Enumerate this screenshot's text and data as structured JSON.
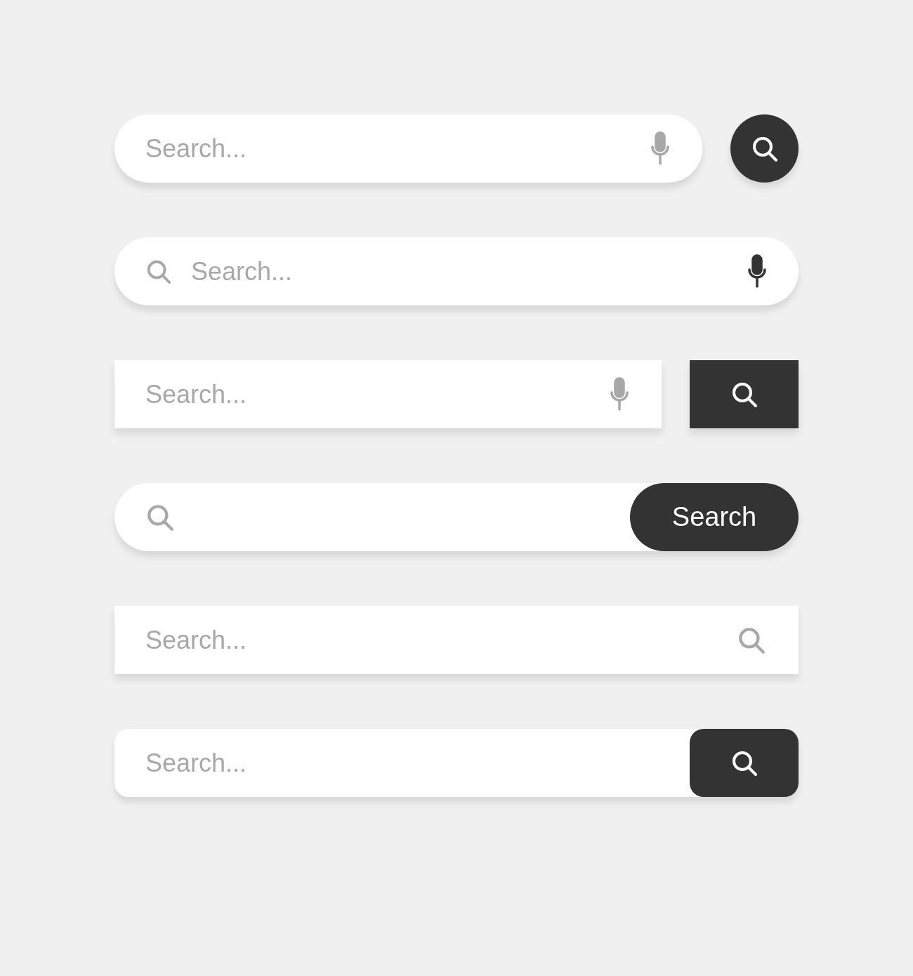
{
  "search_bars": [
    {
      "kind": "pill_mic_round_button",
      "placeholder": "Search..."
    },
    {
      "kind": "pill_icon_mic",
      "placeholder": "Search..."
    },
    {
      "kind": "rect_mic_square_button",
      "placeholder": "Search..."
    },
    {
      "kind": "pill_icon_text_button",
      "button_label": "Search"
    },
    {
      "kind": "rect_trailing_icon",
      "placeholder": "Search..."
    },
    {
      "kind": "rounded_attached_button",
      "placeholder": "Search..."
    }
  ]
}
